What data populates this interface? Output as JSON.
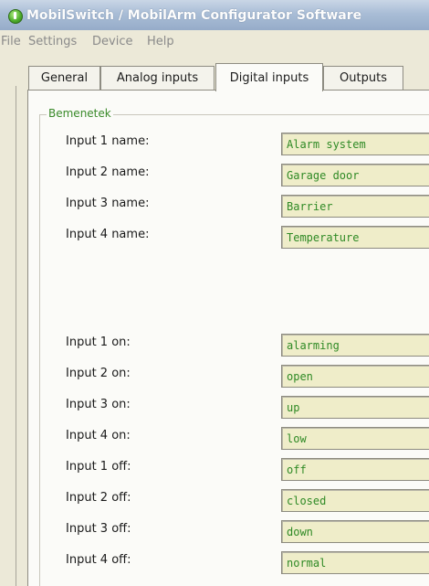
{
  "window": {
    "title": "MobilSwitch / MobilArm Configurator Software"
  },
  "menu": [
    "File",
    "Settings",
    "Device",
    "Help"
  ],
  "tabs": [
    {
      "label": "General",
      "active": false
    },
    {
      "label": "Analog inputs",
      "active": false
    },
    {
      "label": "Digital inputs",
      "active": true
    },
    {
      "label": "Outputs",
      "active": false
    }
  ],
  "group": {
    "legend": "Bemenetek"
  },
  "fields": [
    {
      "label": "Input 1 name:",
      "value": "Alarm system"
    },
    {
      "label": "Input 2 name:",
      "value": "Garage door"
    },
    {
      "label": "Input 3 name:",
      "value": "Barrier"
    },
    {
      "label": "Input 4 name:",
      "value": "Temperature"
    },
    {
      "label": "Input 1 on:",
      "value": "alarming"
    },
    {
      "label": "Input 2 on:",
      "value": "open"
    },
    {
      "label": "Input 3 on:",
      "value": "up"
    },
    {
      "label": "Input 4 on:",
      "value": "low"
    },
    {
      "label": "Input 1 off:",
      "value": "off"
    },
    {
      "label": "Input 2 off:",
      "value": "closed"
    },
    {
      "label": "Input 3 off:",
      "value": "down"
    },
    {
      "label": "Input 4 off:",
      "value": "normal"
    }
  ],
  "colors": {
    "field_bg": "#efedc9",
    "field_text": "#2f8a25",
    "legend_text": "#3a8a2a"
  },
  "icons": {
    "app": "green-power-icon"
  }
}
